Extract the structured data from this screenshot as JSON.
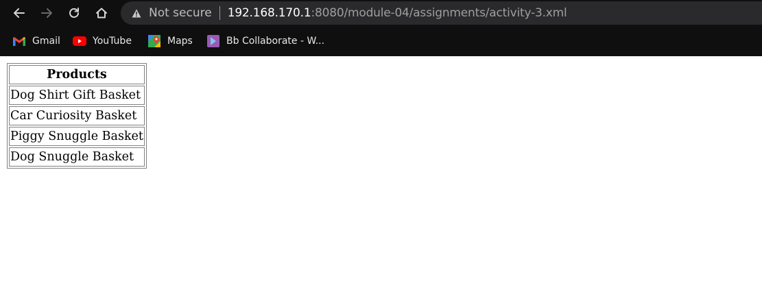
{
  "browser": {
    "security_label": "Not secure",
    "url_host": "192.168.170.1",
    "url_rest": ":8080/module-04/assignments/activity-3.xml",
    "bookmarks": [
      {
        "label": "Gmail",
        "icon": "gmail-icon"
      },
      {
        "label": "YouTube",
        "icon": "youtube-icon"
      },
      {
        "label": "Maps",
        "icon": "maps-icon"
      },
      {
        "label": "Bb Collaborate - W...",
        "icon": "bb-collaborate-icon"
      }
    ]
  },
  "table": {
    "header": "Products",
    "rows": [
      "Dog Shirt Gift Basket",
      "Car Curiosity Basket",
      "Piggy Snuggle Basket",
      "Dog Snuggle Basket"
    ]
  },
  "colors": {
    "chrome_background": "#0f0f0f",
    "address_bar": "#2a2a2c",
    "page_background": "#ffffff"
  }
}
